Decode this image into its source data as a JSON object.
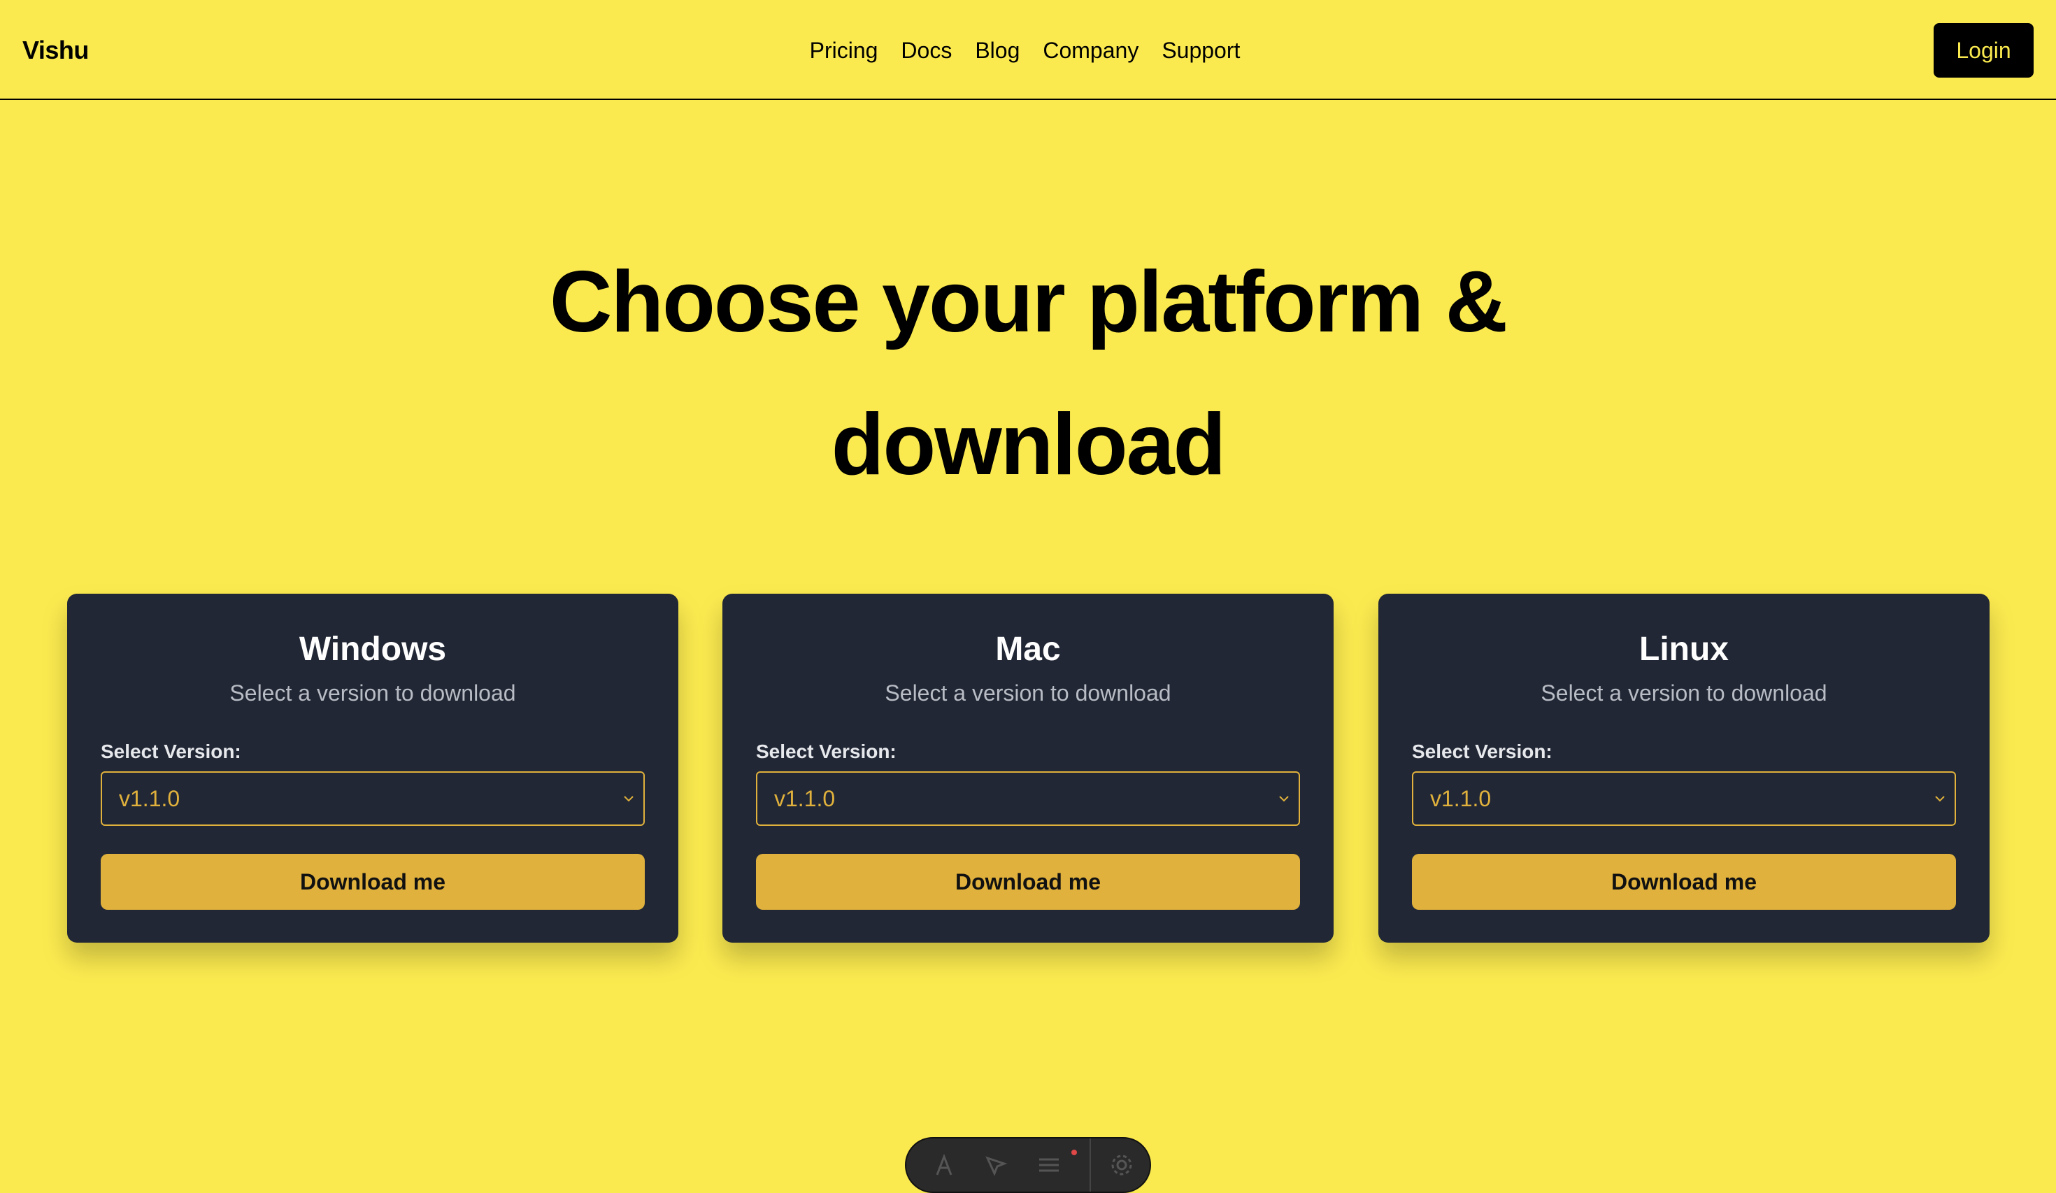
{
  "header": {
    "brand": "Vishu",
    "nav": [
      "Pricing",
      "Docs",
      "Blog",
      "Company",
      "Support"
    ],
    "login_label": "Login"
  },
  "hero": {
    "title_line1": "Choose your platform &",
    "title_line2": "download"
  },
  "platforms": [
    {
      "name": "Windows",
      "subtitle": "Select a version to download",
      "version_label": "Select Version:",
      "selected_version": "v1.1.0",
      "download_label": "Download me"
    },
    {
      "name": "Mac",
      "subtitle": "Select a version to download",
      "version_label": "Select Version:",
      "selected_version": "v1.1.0",
      "download_label": "Download me"
    },
    {
      "name": "Linux",
      "subtitle": "Select a version to download",
      "version_label": "Select Version:",
      "selected_version": "v1.1.0",
      "download_label": "Download me"
    }
  ],
  "toolbar": {
    "icons": [
      "text-icon",
      "cursor-icon",
      "menu-icon",
      "settings-icon"
    ]
  },
  "colors": {
    "background": "#FBEA4F",
    "card": "#212735",
    "accent": "#E0B13C",
    "text": "#000000"
  }
}
